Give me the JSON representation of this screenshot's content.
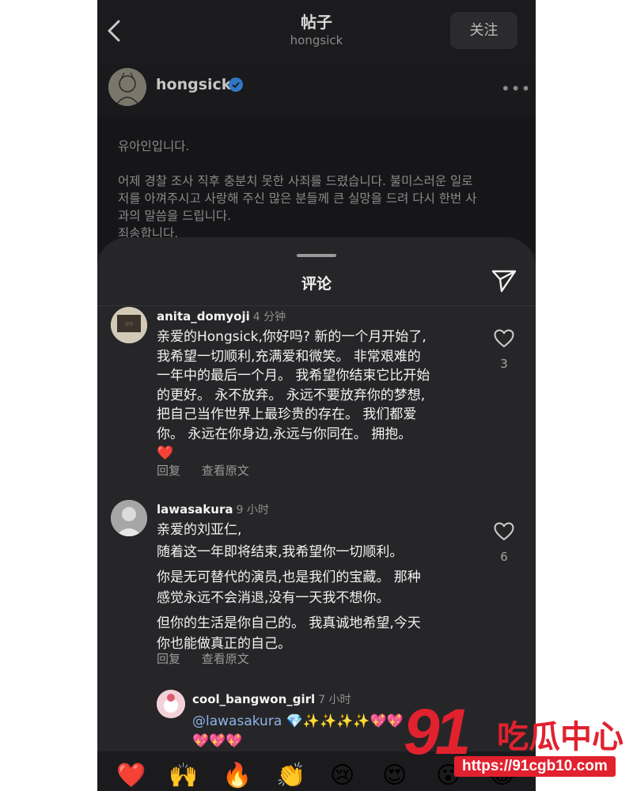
{
  "header": {
    "title": "帖子",
    "subtitle": "hongsick",
    "follow_label": "关注"
  },
  "author": {
    "name": "hongsick"
  },
  "post": {
    "lines": [
      "유아인입니다.",
      "어제 경찰 조사 직후 충분치 못한 사죄를 드렸습니다. 불미스러운 일로",
      "저를 아껴주시고 사랑해 주신 많은 분들께 큰 실망을 드려 다시 한번 사",
      "과의 말씀을 드립니다.",
      "죄송합니다."
    ]
  },
  "sheet": {
    "title": "评论"
  },
  "comments": [
    {
      "user": "anita_domyoji",
      "time": "4 分钟",
      "lines": [
        "亲爱的Hongsick,你好吗? 新的一个月开始了,",
        "我希望一切顺利,充满爱和微笑。 非常艰难的",
        "一年中的最后一个月。 我希望你结束它比开始",
        "的更好。 永不放弃。 永远不要放弃你的梦想,",
        "把自己当作世界上最珍贵的存在。 我们都爱",
        "你。 永远在你身边,永远与你同在。 拥抱。",
        "❤️"
      ],
      "reply_label": "回复",
      "translate_label": "查看原文",
      "likes": "3"
    },
    {
      "user": "lawasakura",
      "time": "9 小时",
      "lines": [
        "亲爱的刘亚仁,",
        "随着这一年即将结束,我希望你一切顺利。",
        "你是无可替代的演员,也是我们的宝藏。 那种",
        "感觉永远不会消退,没有一天我不想你。",
        "但你的生活是你自己的。 我真诚地希望,今天",
        "你也能做真正的自己。"
      ],
      "reply_label": "回复",
      "translate_label": "查看原文",
      "likes": "6"
    },
    {
      "user": "cool_bangwon_girl",
      "time": "7 小时",
      "mention": "@lawasakura",
      "emoji_line1": "💎✨✨✨✨💖💖",
      "emoji_line2": "💖💖💖"
    }
  ],
  "emoji_bar": [
    "❤️",
    "🙌",
    "🔥",
    "👏",
    "😢",
    "😍",
    "😮",
    "😂"
  ],
  "watermark": {
    "logo_number": "91",
    "logo_text": "吃瓜中心",
    "url": "https://91cgb10.com"
  },
  "colors": {
    "background": "#1b1b1d",
    "sheet": "#262628",
    "accent_link": "#8fb2e8",
    "verified": "#2f78c4",
    "watermark": "#e2212f"
  }
}
